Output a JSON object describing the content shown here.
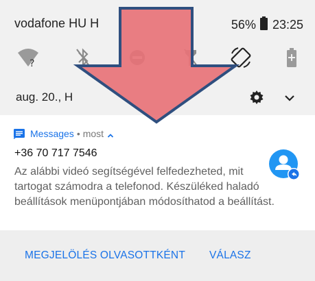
{
  "status_bar": {
    "carrier": "vodafone HU H",
    "battery_percent": "56%",
    "time": "23:25"
  },
  "quick_settings": {
    "tiles": [
      {
        "icon": "wifi-unknown-icon"
      },
      {
        "icon": "bluetooth-off-icon"
      },
      {
        "icon": "do-not-disturb-icon"
      },
      {
        "icon": "flashlight-off-icon"
      },
      {
        "icon": "auto-rotate-icon"
      },
      {
        "icon": "battery-saver-icon"
      }
    ],
    "date": "aug. 20., H"
  },
  "notification": {
    "app_name": "Messages",
    "separator": "•",
    "time": "most",
    "sender": "+36 70 717 7546",
    "body": "Az alábbi videó segítségével felfedezheted, mit tartogat számodra a telefonod. Készüléked haladó beállítások menüpontjában módosíthatod a beállítást.",
    "accent_color": "#1a73e8"
  },
  "actions": {
    "mark_read": "MEGJELÖLÉS OLVASOTTKÉNT",
    "reply": "VÁLASZ"
  },
  "overlay": {
    "arrow_fill": "#e87378",
    "arrow_stroke": "#2f4f7f"
  }
}
